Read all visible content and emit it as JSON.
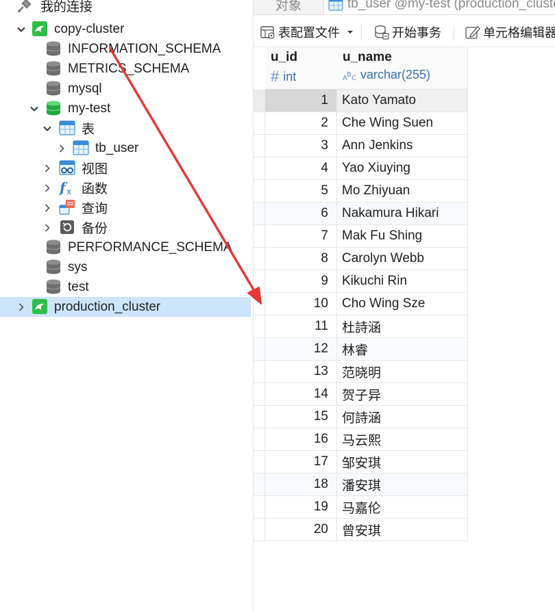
{
  "tree": {
    "header": "我的连接",
    "connections": [
      {
        "label": "copy-cluster"
      },
      {
        "label": "production_cluster"
      }
    ],
    "databases": [
      {
        "label": "INFORMATION_SCHEMA"
      },
      {
        "label": "METRICS_SCHEMA"
      },
      {
        "label": "mysql"
      },
      {
        "label": "my-test"
      },
      {
        "label": "PERFORMANCE_SCHEMA"
      },
      {
        "label": "sys"
      },
      {
        "label": "test"
      }
    ],
    "my_test_children": [
      {
        "label": "表"
      },
      {
        "label": "tb_user"
      },
      {
        "label": "视图"
      },
      {
        "label": "函数"
      },
      {
        "label": "查询"
      },
      {
        "label": "备份"
      }
    ]
  },
  "tabs": {
    "objects": "对象",
    "table_tab": "tb_user @my-test (production_cluster)"
  },
  "toolbar": {
    "table_config": "表配置文件",
    "begin_transaction": "开始事务",
    "cell_editor": "单元格编辑器"
  },
  "grid": {
    "columns": [
      {
        "name": "u_id",
        "type": "int",
        "type_icon": "hash-icon"
      },
      {
        "name": "u_name",
        "type": "varchar(255)",
        "type_icon": "abc-icon"
      }
    ],
    "rows": [
      {
        "u_id": "1",
        "u_name": "Kato Yamato"
      },
      {
        "u_id": "2",
        "u_name": "Che Wing Suen"
      },
      {
        "u_id": "3",
        "u_name": "Ann Jenkins"
      },
      {
        "u_id": "4",
        "u_name": "Yao Xiuying"
      },
      {
        "u_id": "5",
        "u_name": "Mo Zhiyuan"
      },
      {
        "u_id": "6",
        "u_name": "Nakamura Hikari"
      },
      {
        "u_id": "7",
        "u_name": "Mak Fu Shing"
      },
      {
        "u_id": "8",
        "u_name": "Carolyn Webb"
      },
      {
        "u_id": "9",
        "u_name": "Kikuchi Rin"
      },
      {
        "u_id": "10",
        "u_name": "Cho Wing Sze"
      },
      {
        "u_id": "11",
        "u_name": "杜詩涵"
      },
      {
        "u_id": "12",
        "u_name": "林睿"
      },
      {
        "u_id": "13",
        "u_name": "范晓明"
      },
      {
        "u_id": "14",
        "u_name": "贺子异"
      },
      {
        "u_id": "15",
        "u_name": "何詩涵"
      },
      {
        "u_id": "16",
        "u_name": "马云熙"
      },
      {
        "u_id": "17",
        "u_name": "邹安琪"
      },
      {
        "u_id": "18",
        "u_name": "潘安琪"
      },
      {
        "u_id": "19",
        "u_name": "马嘉伦"
      },
      {
        "u_id": "20",
        "u_name": "曾安琪"
      }
    ]
  },
  "colors": {
    "selection": "#cce5fb",
    "connection_green": "#2fbf49",
    "annotation_arrow": "#e53935"
  }
}
